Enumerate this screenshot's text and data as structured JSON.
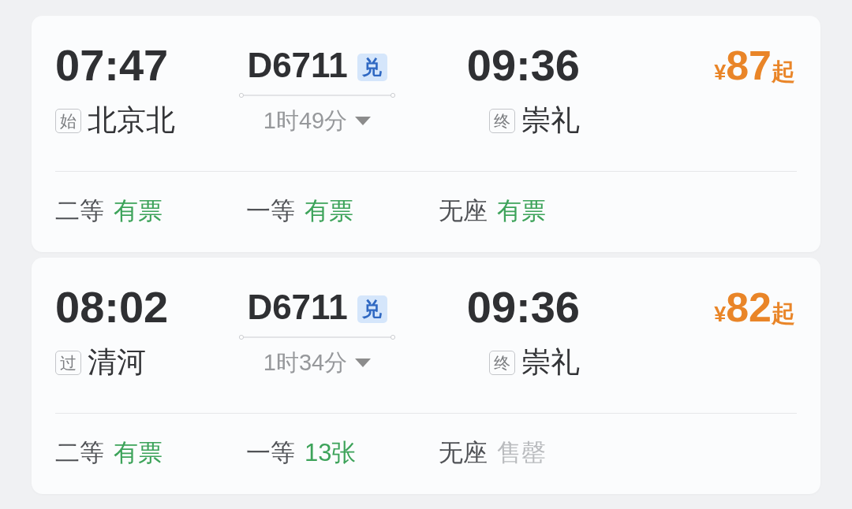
{
  "trains": [
    {
      "depart": {
        "time": "07:47",
        "station_tag": "始",
        "station": "北京北"
      },
      "train": {
        "number": "D6711",
        "tag": "兑",
        "duration": "1时49分"
      },
      "arrive": {
        "time": "09:36",
        "station_tag": "终",
        "station": "崇礼"
      },
      "price": {
        "currency": "¥",
        "amount": "87",
        "suffix": "起"
      },
      "seats": [
        {
          "class": "二等",
          "availability": "有票",
          "available": true
        },
        {
          "class": "一等",
          "availability": "有票",
          "available": true
        },
        {
          "class": "无座",
          "availability": "有票",
          "available": true
        }
      ]
    },
    {
      "depart": {
        "time": "08:02",
        "station_tag": "过",
        "station": "清河"
      },
      "train": {
        "number": "D6711",
        "tag": "兑",
        "duration": "1时34分"
      },
      "arrive": {
        "time": "09:36",
        "station_tag": "终",
        "station": "崇礼"
      },
      "price": {
        "currency": "¥",
        "amount": "82",
        "suffix": "起"
      },
      "seats": [
        {
          "class": "二等",
          "availability": "有票",
          "available": true
        },
        {
          "class": "一等",
          "availability": "13张",
          "available": true
        },
        {
          "class": "无座",
          "availability": "售罄",
          "available": false
        }
      ]
    }
  ]
}
